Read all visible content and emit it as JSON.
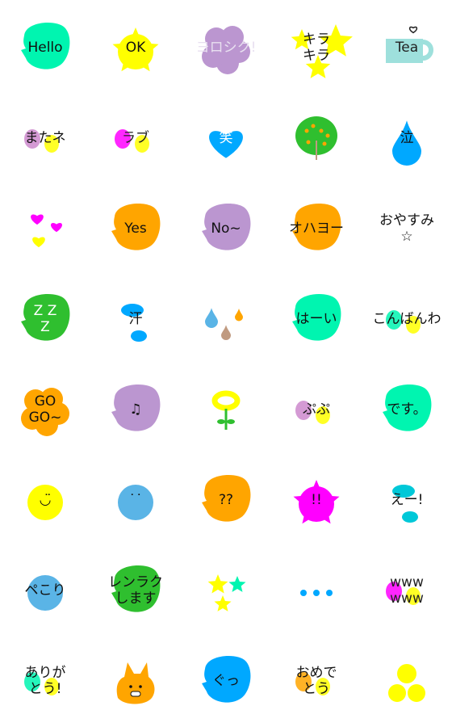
{
  "items": [
    {
      "name": "hello",
      "text": "Hello",
      "shape": "blob",
      "bg": "#00f5b0",
      "fg": "#111"
    },
    {
      "name": "ok",
      "text": "OK",
      "shape": "burst",
      "bg": "#ffff00",
      "fg": "#111"
    },
    {
      "name": "yoroshiku",
      "text": "ヨロシク!",
      "shape": "cloud",
      "bg": "#bb96d0",
      "fg": "#e8e0f0"
    },
    {
      "name": "kirakira",
      "text": "キラ  \n  キラ",
      "shape": "sparkle",
      "bg": "#ffff00",
      "fg": "#111"
    },
    {
      "name": "tea",
      "text": "Tea",
      "shape": "cup",
      "bg": "#9ee0dc",
      "fg": "#222"
    },
    {
      "name": "matane",
      "text": "またネ",
      "shape": "dots2",
      "bg": "#cc88cc",
      "fg": "#111"
    },
    {
      "name": "rabu",
      "text": "ラブ",
      "shape": "dots2",
      "bg": "#ff00ff",
      "fg": "#222"
    },
    {
      "name": "warai",
      "text": "笑",
      "shape": "heart",
      "bg": "#00a8ff",
      "fg": "#fff"
    },
    {
      "name": "tree",
      "text": "",
      "shape": "tree",
      "bg": "#2fbf2f",
      "fg": "#111"
    },
    {
      "name": "naku",
      "text": "泣",
      "shape": "drop",
      "bg": "#00a8ff",
      "fg": "#111"
    },
    {
      "name": "hearts",
      "text": "",
      "shape": "hearts",
      "bg": "#ff00ff",
      "fg": "#111"
    },
    {
      "name": "yes",
      "text": "Yes",
      "shape": "blob",
      "bg": "#ffa500",
      "fg": "#111"
    },
    {
      "name": "no",
      "text": "No~",
      "shape": "blob",
      "bg": "#bb96d0",
      "fg": "#111"
    },
    {
      "name": "ohayo",
      "text": "オハヨー",
      "shape": "blob",
      "bg": "#ffa500",
      "fg": "#111"
    },
    {
      "name": "oyasumi",
      "text": "おやすみ\n      ☆",
      "shape": "none",
      "bg": "#c09a80",
      "fg": "#111"
    },
    {
      "name": "zzz",
      "text": "Z Z\n Z",
      "shape": "blob",
      "bg": "#2fbf2f",
      "fg": "#fff"
    },
    {
      "name": "ase",
      "text": "   汗",
      "shape": "splash",
      "bg": "#00a8ff",
      "fg": "#111"
    },
    {
      "name": "drops",
      "text": "",
      "shape": "drops",
      "bg": "#5ab4e6",
      "fg": "#111"
    },
    {
      "name": "haai",
      "text": "はーい",
      "shape": "blob",
      "bg": "#00f5b0",
      "fg": "#111"
    },
    {
      "name": "konbanwa",
      "text": "こんばんわ",
      "shape": "dots2",
      "bg": "#00f5b0",
      "fg": "#111"
    },
    {
      "name": "gogo",
      "text": "GO\nGO~",
      "shape": "cloud",
      "bg": "#ffa500",
      "fg": "#111"
    },
    {
      "name": "music",
      "text": "♫",
      "shape": "blob",
      "bg": "#bb96d0",
      "fg": "#111"
    },
    {
      "name": "flower",
      "text": "",
      "shape": "flower",
      "bg": "#ffff00",
      "fg": "#111"
    },
    {
      "name": "pupu",
      "text": "ぷぷ",
      "shape": "dots2",
      "bg": "#cc88cc",
      "fg": "#111"
    },
    {
      "name": "desu",
      "text": "です。",
      "shape": "blob",
      "bg": "#00f5b0",
      "fg": "#111"
    },
    {
      "name": "smile",
      "text": "◡̈",
      "shape": "circle",
      "bg": "#ffff00",
      "fg": "#111"
    },
    {
      "name": "face",
      "text": "˙˙",
      "shape": "circle",
      "bg": "#5ab4e6",
      "fg": "#111"
    },
    {
      "name": "question",
      "text": "??",
      "shape": "blob",
      "bg": "#ffa500",
      "fg": "#111"
    },
    {
      "name": "exclaim",
      "text": "!!",
      "shape": "burst",
      "bg": "#ff00ff",
      "fg": "#111"
    },
    {
      "name": "ee",
      "text": "えー!",
      "shape": "splash",
      "bg": "#00c8d8",
      "fg": "#111"
    },
    {
      "name": "pekori",
      "text": "ペこり",
      "shape": "circle",
      "bg": "#5ab4e6",
      "fg": "#111"
    },
    {
      "name": "renraku",
      "text": "レンラク\nします",
      "shape": "blob",
      "bg": "#2fbf2f",
      "fg": "#111"
    },
    {
      "name": "stars",
      "text": "",
      "shape": "stars",
      "bg": "#ffff00",
      "fg": "#111"
    },
    {
      "name": "dots",
      "text": "",
      "shape": "dots",
      "bg": "#00a8ff",
      "fg": "#111"
    },
    {
      "name": "www",
      "text": "www\nwww",
      "shape": "dots2",
      "bg": "#ff00ff",
      "fg": "#222"
    },
    {
      "name": "arigatou",
      "text": "ありが\n とう!",
      "shape": "dots2",
      "bg": "#00f5b0",
      "fg": "#111"
    },
    {
      "name": "cat",
      "text": "",
      "shape": "cat",
      "bg": "#ffa500",
      "fg": "#111"
    },
    {
      "name": "guu",
      "text": "ぐっ",
      "shape": "blob",
      "bg": "#00a8ff",
      "fg": "#111"
    },
    {
      "name": "omedetou",
      "text": "おめで\n とう",
      "shape": "dots2",
      "bg": "#ffa500",
      "fg": "#111"
    },
    {
      "name": "smiles",
      "text": "",
      "shape": "smiles",
      "bg": "#ffff00",
      "fg": "#111"
    }
  ]
}
